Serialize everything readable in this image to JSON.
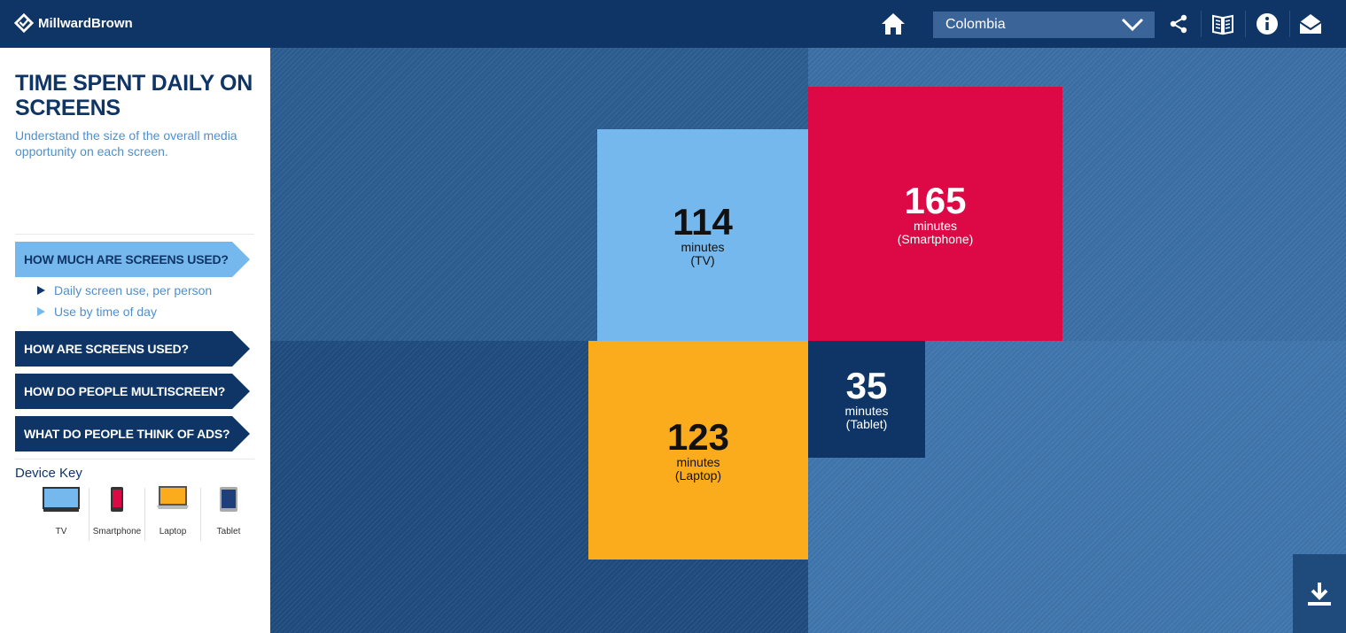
{
  "header": {
    "brand": "MillwardBrown",
    "country_selected": "Colombia"
  },
  "sidebar": {
    "title": "TIME SPENT DAILY ON SCREENS",
    "subtitle": "Understand the size of the overall media opportunity on each screen.",
    "nav": [
      {
        "label": "HOW MUCH ARE SCREENS USED?",
        "active": true
      },
      {
        "label": "HOW ARE SCREENS USED?",
        "active": false
      },
      {
        "label": "HOW DO PEOPLE MULTISCREEN?",
        "active": false
      },
      {
        "label": "WHAT DO PEOPLE THINK OF ADS?",
        "active": false
      }
    ],
    "subnav": [
      {
        "label": "Daily screen use, per person",
        "active": true
      },
      {
        "label": "Use by time of day",
        "active": false
      }
    ],
    "device_key_title": "Device Key",
    "devices": [
      {
        "label": "TV",
        "icon": "tv-icon",
        "color": "#74b8ed"
      },
      {
        "label": "Smartphone",
        "icon": "smartphone-icon",
        "color": "#dc0946"
      },
      {
        "label": "Laptop",
        "icon": "laptop-icon",
        "color": "#fbac1c"
      },
      {
        "label": "Tablet",
        "icon": "tablet-icon",
        "color": "#0f3566"
      }
    ]
  },
  "blocks": {
    "tv": {
      "value": "114",
      "unit": "minutes",
      "device": "(TV)"
    },
    "smartphone": {
      "value": "165",
      "unit": "minutes",
      "device": "(Smartphone)"
    },
    "laptop": {
      "value": "123",
      "unit": "minutes",
      "device": "(Laptop)"
    },
    "tablet": {
      "value": "35",
      "unit": "minutes",
      "device": "(Tablet)"
    }
  },
  "colors": {
    "navy": "#0f3566",
    "tv": "#74b8ed",
    "smartphone": "#dc0946",
    "laptop": "#fbac1c",
    "tablet": "#0f3566"
  },
  "icons": [
    "home-icon",
    "chevron-down-icon",
    "share-icon",
    "book-icon",
    "info-icon",
    "mail-icon",
    "download-icon"
  ]
}
